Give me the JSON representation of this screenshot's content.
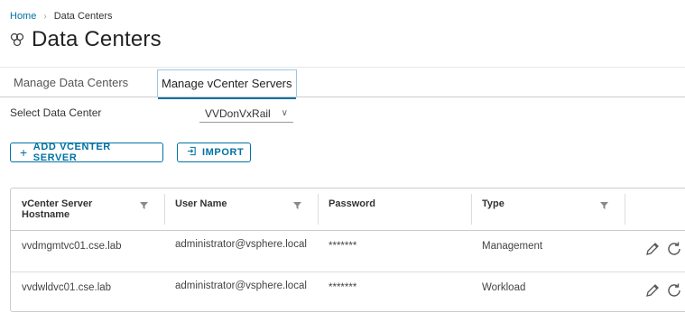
{
  "breadcrumb": {
    "home": "Home",
    "current": "Data Centers"
  },
  "page": {
    "title": "Data Centers",
    "icon": "datacenter-icon"
  },
  "tabs": [
    {
      "label": "Manage Data Centers",
      "active": false
    },
    {
      "label": "Manage vCenter Servers",
      "active": true
    }
  ],
  "selector": {
    "label": "Select Data Center",
    "value": "VVDonVxRail"
  },
  "buttons": {
    "add": "ADD VCENTER SERVER",
    "import": "IMPORT"
  },
  "colors": {
    "accent": "#0072a3"
  },
  "table": {
    "columns": [
      "vCenter Server Hostname",
      "User Name",
      "Password",
      "Type"
    ],
    "rows": [
      {
        "hostname": "vvdmgmtvc01.cse.lab",
        "username": "administrator@vsphere.local",
        "password": "*******",
        "type": "Management"
      },
      {
        "hostname": "vvdwldvc01.cse.lab",
        "username": "administrator@vsphere.local",
        "password": "*******",
        "type": "Workload"
      }
    ]
  }
}
